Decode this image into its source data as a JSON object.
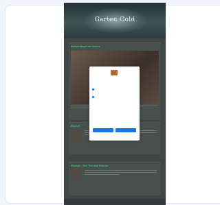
{
  "site": {
    "title": "Garten Gold",
    "posts": [
      {
        "title": "Rotkohlkopf im Garten",
        "meta": "",
        "more": ""
      },
      {
        "title": "Rezept",
        "meta": "",
        "more": ""
      },
      {
        "title": "Rezept – Der Tee das Reiche",
        "meta": "",
        "more": ""
      }
    ],
    "footer": ""
  },
  "consent": {
    "title": "",
    "subtitle": "",
    "options": [
      {
        "icon": "person-icon",
        "text": ""
      },
      {
        "icon": "chart-icon",
        "text": ""
      }
    ],
    "manage_label": "",
    "fine_print": "",
    "reject_label": "",
    "accept_label": "",
    "bottom_text": ""
  },
  "colors": {
    "page_background": "#f1f4f9",
    "site_background": "#3f4846",
    "post_title": "#3ec27e",
    "dialog_button": "#1a73e8"
  }
}
